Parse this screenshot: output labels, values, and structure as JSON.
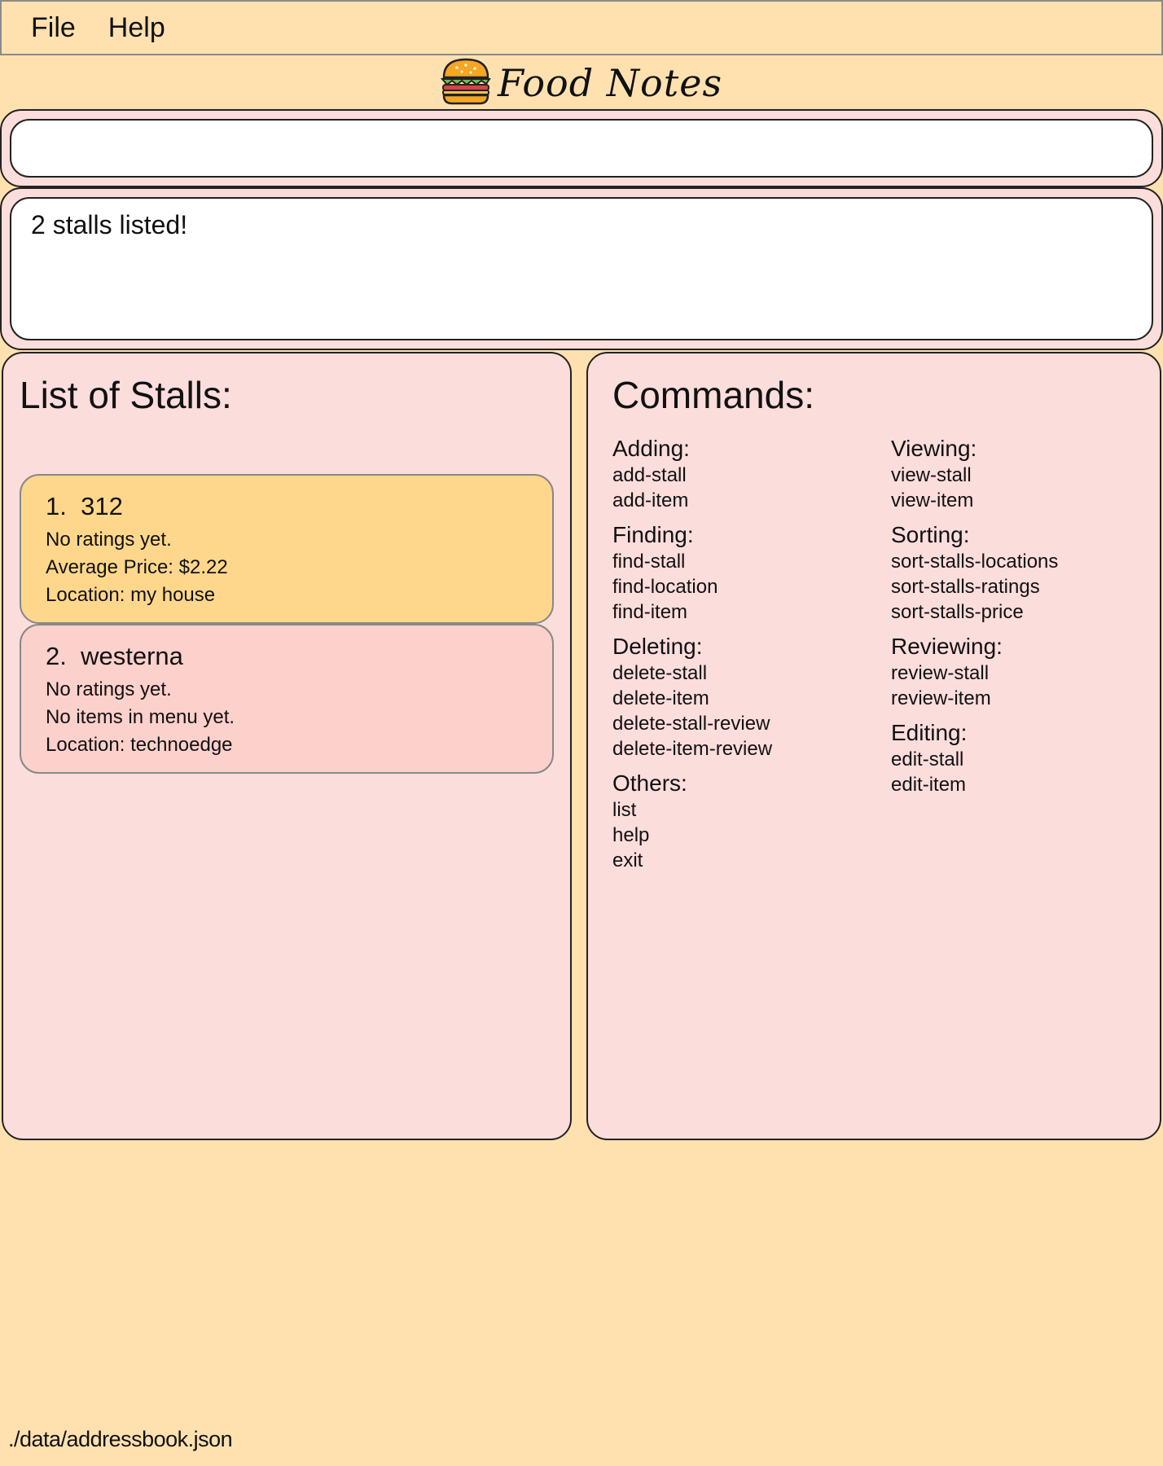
{
  "menu": {
    "file": "File",
    "help": "Help"
  },
  "logo": {
    "icon": "burger-icon",
    "text": "Food Notes"
  },
  "command_input": {
    "value": ""
  },
  "result": {
    "text": "2 stalls listed!"
  },
  "stalls_panel": {
    "title": "List of Stalls:",
    "stalls": [
      {
        "index": "1.",
        "name": "312",
        "rating": "No ratings yet.",
        "info": "Average Price: $2.22",
        "location": "Location: my house",
        "color": "#ffd78c"
      },
      {
        "index": "2.",
        "name": "westerna",
        "rating": "No ratings yet.",
        "info": "No items in menu yet.",
        "location": "Location: technoedge",
        "color": "#fcd0cb"
      }
    ]
  },
  "commands_panel": {
    "title": "Commands:",
    "left": [
      {
        "head": "Adding:",
        "items": [
          "add-stall",
          "add-item"
        ]
      },
      {
        "head": "Finding:",
        "items": [
          "find-stall",
          "find-location",
          "find-item"
        ]
      },
      {
        "head": "Deleting:",
        "items": [
          "delete-stall",
          "delete-item",
          "delete-stall-review",
          "delete-item-review"
        ]
      },
      {
        "head": "Others:",
        "items": [
          "list",
          "help",
          "exit"
        ]
      }
    ],
    "right": [
      {
        "head": "Viewing:",
        "items": [
          "view-stall",
          "view-item"
        ]
      },
      {
        "head": "Sorting:",
        "items": [
          "sort-stalls-locations",
          "sort-stalls-ratings",
          "sort-stalls-price"
        ]
      },
      {
        "head": "Reviewing:",
        "items": [
          "review-stall",
          "review-item"
        ]
      },
      {
        "head": "Editing:",
        "items": [
          "edit-stall",
          "edit-item"
        ]
      }
    ]
  },
  "status_bar": {
    "path": "./data/addressbook.json"
  },
  "colors": {
    "background": "#ffe1b0",
    "panel": "#fbdddb",
    "card_selected": "#ffd78c",
    "card": "#fcd0cb"
  }
}
